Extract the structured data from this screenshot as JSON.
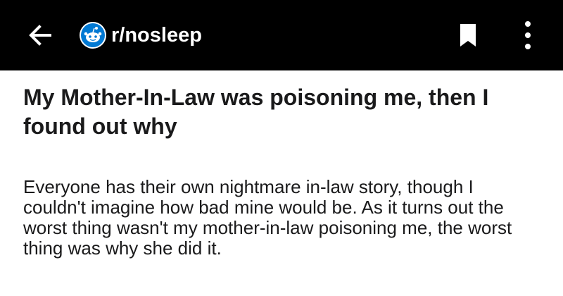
{
  "header": {
    "subreddit": "r/nosleep",
    "back_icon": "arrow-left-icon",
    "avatar_icon": "reddit-snoo-icon",
    "save_icon": "bookmark-icon",
    "more_icon": "more-vertical-icon",
    "background_color": "#000000",
    "avatar_color": "#0079d3"
  },
  "post": {
    "title": "My Mother-In-Law was poisoning me, then I found out why",
    "body": "Everyone has their own nightmare in-law story, though I couldn't imagine how bad mine would be. As it turns out the worst thing wasn't my mother-in-law poisoning me, the worst thing was why she did it."
  }
}
